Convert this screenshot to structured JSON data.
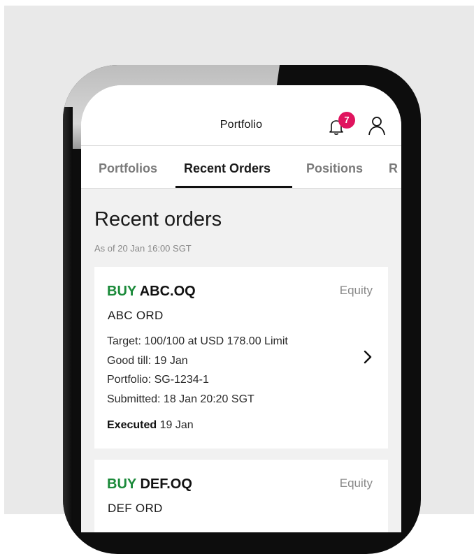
{
  "header": {
    "title": "Portfolio",
    "notification_count": "7",
    "accent": "#e0145e"
  },
  "tabs": [
    {
      "label": "Portfolios",
      "active": false
    },
    {
      "label": "Recent Orders",
      "active": true
    },
    {
      "label": "Positions",
      "active": false
    },
    {
      "label": "R",
      "active": false
    }
  ],
  "page": {
    "heading": "Recent orders",
    "as_of": "As of 20 Jan 16:00 SGT"
  },
  "orders": [
    {
      "side": "BUY",
      "symbol": "ABC.OQ",
      "type": "Equity",
      "name": "ABC ORD",
      "target": "Target: 100/100 at USD 178.00 Limit",
      "good_till": "Good till: 19 Jan",
      "portfolio": "Portfolio: SG-1234-1",
      "submitted": "Submitted: 18 Jan 20:20 SGT",
      "status_label": "Executed",
      "status_date": "19 Jan"
    },
    {
      "side": "BUY",
      "symbol": "DEF.OQ",
      "type": "Equity",
      "name": "DEF ORD"
    }
  ],
  "colors": {
    "buy": "#1b8a3a",
    "background": "#f1f1f1"
  }
}
